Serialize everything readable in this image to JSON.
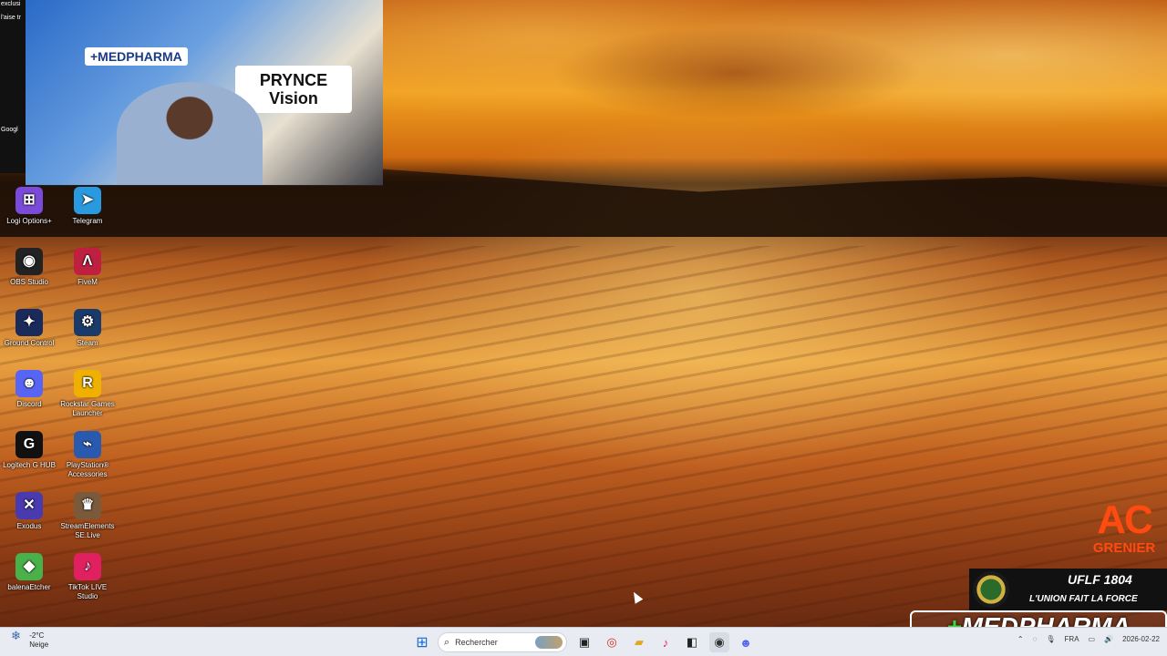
{
  "overlay": {
    "webcam_brand": "+MEDPHARMA",
    "webcam_logo_line1": "PRYNCE",
    "webcam_logo_line2": "Vision",
    "ac_big": "AC",
    "ac_small": "GRENIER",
    "uflf_title": "UFLF 1804",
    "uflf_motto": "L'UNION FAIT LA FORCE",
    "medpharma_banner": "MEDPHARMA"
  },
  "chat_strip": [
    "exclusi",
    "",
    "",
    "",
    "l'aise tr",
    "",
    "",
    "Googl"
  ],
  "desktop_icons": [
    {
      "label": "Logi Options+",
      "glyph": "⊞",
      "color": "#7a4ad8"
    },
    {
      "label": "Telegram",
      "glyph": "➤",
      "color": "#2a9ae0"
    },
    {
      "label": "OBS Studio",
      "glyph": "◉",
      "color": "#222"
    },
    {
      "label": "FiveM",
      "glyph": "Λ",
      "color": "#c02040"
    },
    {
      "label": "Ground Control",
      "glyph": "✦",
      "color": "#1a2a5a"
    },
    {
      "label": "Steam",
      "glyph": "⚙",
      "color": "#1a3a6a"
    },
    {
      "label": "Discord",
      "glyph": "☻",
      "color": "#5865f2"
    },
    {
      "label": "Rockstar Games Launcher",
      "glyph": "R",
      "color": "#f0b000"
    },
    {
      "label": "Logitech G HUB",
      "glyph": "G",
      "color": "#111"
    },
    {
      "label": "PlayStation® Accessories",
      "glyph": "⌁",
      "color": "#2a5ab0"
    },
    {
      "label": "Exodus",
      "glyph": "✕",
      "color": "#4a3ab0"
    },
    {
      "label": "StreamElements SE.Live",
      "glyph": "♛",
      "color": "#7a5a3a"
    },
    {
      "label": "balenaEtcher",
      "glyph": "◆",
      "color": "#4ab04a"
    },
    {
      "label": "TikTok LIVE Studio",
      "glyph": "♪",
      "color": "#e02060"
    }
  ],
  "taskbar": {
    "weather_temp": "-2°C",
    "weather_cond": "Neige",
    "search_placeholder": "Rechercher",
    "lang": "FRA",
    "date": "2026-02-22"
  },
  "colors": {
    "taskbar_bg": "#e8ecf2",
    "accent": "#ff4a10"
  }
}
